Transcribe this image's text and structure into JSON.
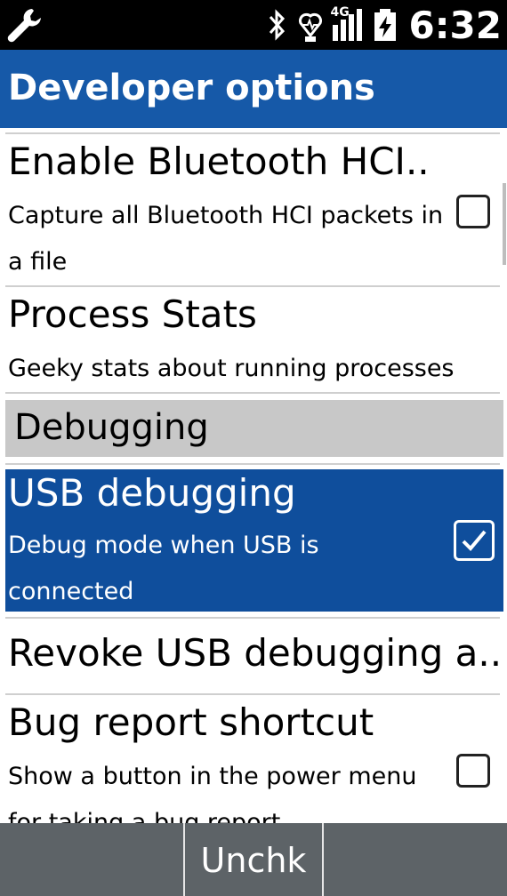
{
  "status_bar": {
    "network_type": "4G",
    "time": "6:32",
    "icons": [
      "wrench-icon",
      "bluetooth-icon",
      "heart-pulse-icon",
      "signal-icon",
      "battery-charging-icon"
    ]
  },
  "header": {
    "title": "Developer options"
  },
  "list": {
    "items": [
      {
        "title": "Enable Bluetooth HCI..",
        "subtitle": "Capture all Bluetooth HCI packets in a file",
        "checked": false
      },
      {
        "title": "Process Stats",
        "subtitle": "Geeky stats about running processes"
      },
      {
        "category": "Debugging"
      },
      {
        "title": "USB debugging",
        "subtitle": "Debug mode when USB is connected",
        "checked": true,
        "selected": true
      },
      {
        "title": "Revoke USB debugging a.."
      },
      {
        "title": "Bug report shortcut",
        "subtitle": "Show a button in the power menu for taking a bug report",
        "checked": false
      }
    ]
  },
  "softkeys": {
    "left": "",
    "center": "Unchk",
    "right": ""
  },
  "colors": {
    "header": "#1659a8",
    "selected": "#0f4e9c",
    "category": "#c8c8c8",
    "softkey_bar": "#5d6367"
  }
}
